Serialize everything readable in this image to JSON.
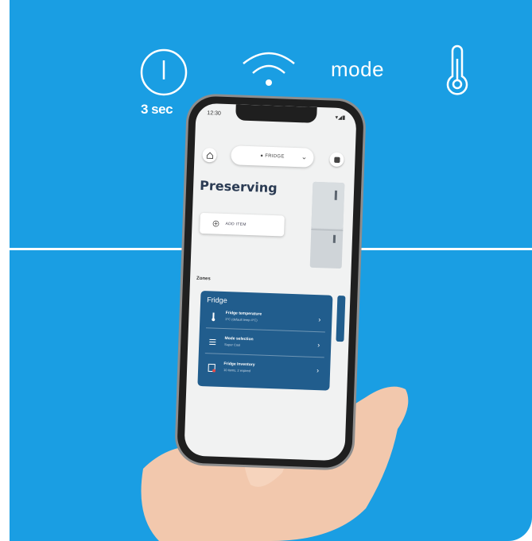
{
  "background": {
    "accent": "#1a9ee3",
    "card": "#215d8d"
  },
  "top_icons": {
    "power_icon": "power-icon",
    "power_hold": "3 sec",
    "wifi_icon": "wifi-icon",
    "mode_label": "mode",
    "thermometer_icon": "thermometer-icon"
  },
  "phone": {
    "status": {
      "time": "12:30",
      "icons": "▾◢▮"
    },
    "header": {
      "fridge_select": "● FRIDGE"
    },
    "title": "Preserving",
    "add_item": "ADD ITEM",
    "zones_label": "Zones",
    "card": {
      "title": "Fridge",
      "rows": [
        {
          "title": "Fridge temperature",
          "subtitle": "3°C (default temp 4°C)",
          "icon": "thermometer-icon"
        },
        {
          "title": "Mode selection",
          "subtitle": "Super Cool",
          "icon": "menu-icon"
        },
        {
          "title": "Fridge Inventory",
          "subtitle": "10 items, 2 expired",
          "icon": "inventory-icon"
        }
      ]
    }
  }
}
